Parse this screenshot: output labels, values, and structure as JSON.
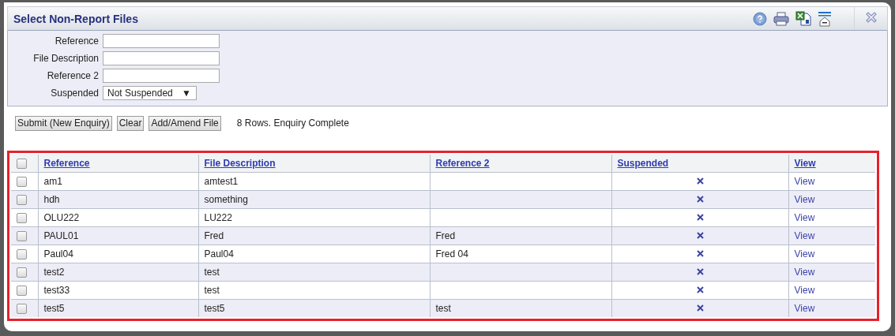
{
  "window": {
    "title": "Select Non-Report Files"
  },
  "filters": [
    {
      "kind": "text",
      "label": "Reference"
    },
    {
      "kind": "text",
      "label": "File Description"
    },
    {
      "kind": "text",
      "label": "Reference 2"
    },
    {
      "kind": "select",
      "label": "Suspended",
      "value": "Not Suspended",
      "arrow": "▼"
    }
  ],
  "buttons": [
    "Submit (New Enquiry)",
    "Clear",
    "Add/Amend File"
  ],
  "status": "8 Rows. Enquiry Complete",
  "table": {
    "all_checked": false,
    "columns": [
      "Reference",
      "File Description",
      "Reference 2",
      "Suspended",
      "View"
    ],
    "rows": [
      {
        "checked": false,
        "reference": "am1",
        "description": "amtest1",
        "reference_2": "",
        "suspended": false,
        "view": "View"
      },
      {
        "checked": false,
        "reference": "hdh",
        "description": "something",
        "reference_2": "",
        "suspended": false,
        "view": "View"
      },
      {
        "checked": false,
        "reference": "OLU222",
        "description": "LU222",
        "reference_2": "",
        "suspended": false,
        "view": "View"
      },
      {
        "checked": false,
        "reference": "PAUL01",
        "description": "Fred",
        "reference_2": "Fred",
        "suspended": false,
        "view": "View"
      },
      {
        "checked": false,
        "reference": "Paul04",
        "description": "Paul04",
        "reference_2": "Fred 04",
        "suspended": false,
        "view": "View"
      },
      {
        "checked": false,
        "reference": "test2",
        "description": "test",
        "reference_2": "",
        "suspended": false,
        "view": "View"
      },
      {
        "checked": false,
        "reference": "test33",
        "description": "test",
        "reference_2": "",
        "suspended": false,
        "view": "View"
      },
      {
        "checked": false,
        "reference": "test5",
        "description": "test5",
        "reference_2": "test",
        "suspended": false,
        "view": "View"
      }
    ]
  }
}
